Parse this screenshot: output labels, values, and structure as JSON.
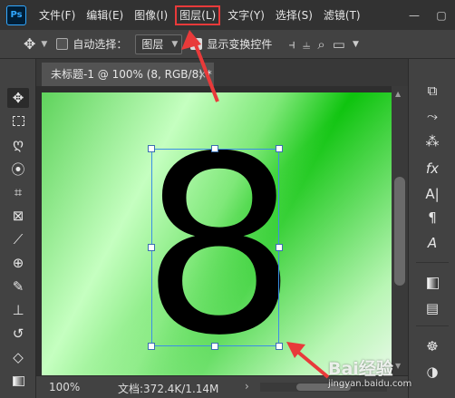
{
  "app": {
    "logo_text": "Ps"
  },
  "menu": {
    "items": [
      {
        "label": "文件(F)"
      },
      {
        "label": "编辑(E)"
      },
      {
        "label": "图像(I)"
      },
      {
        "label": "图层(L)",
        "highlighted": true
      },
      {
        "label": "文字(Y)"
      },
      {
        "label": "选择(S)"
      },
      {
        "label": "滤镜(T)"
      }
    ],
    "highlight_color": "#e83a3a"
  },
  "options": {
    "auto_select_label": "自动选择：",
    "auto_select_checked": false,
    "target_select_value": "图层",
    "show_transform_label": "显示变换控件",
    "show_transform_checked": true
  },
  "document_tab": {
    "title": "未标题-1 @ 100% (8, RGB/8) *",
    "close": "×"
  },
  "canvas": {
    "content_text": "8",
    "gradient_colors": [
      "#0fc40f",
      "#c5ffc0"
    ]
  },
  "status": {
    "zoom": "100%",
    "doc_info": "文档:372.4K/1.14M",
    "arrow": "›"
  },
  "watermark": {
    "main": "Bai经验",
    "sub": "jingyan.baidu.com"
  },
  "tools_left": [
    "move-tool-icon",
    "marquee-tool-icon",
    "lasso-tool-icon",
    "quick-select-icon",
    "crop-tool-icon",
    "frame-tool-icon",
    "eyedropper-icon",
    "healing-brush-icon",
    "brush-tool-icon",
    "stamp-tool-icon",
    "history-brush-icon",
    "eraser-icon",
    "gradient-tool-icon"
  ],
  "tools_right": [
    "history-panel-icon",
    "paths-panel-icon",
    "channels-panel-icon",
    "styles-panel-icon",
    "character-panel-icon",
    "paragraph-panel-icon",
    "glyphs-panel-icon",
    "swatches-panel-icon",
    "notes-panel-icon",
    "color-panel-icon",
    "adjustments-panel-icon"
  ]
}
